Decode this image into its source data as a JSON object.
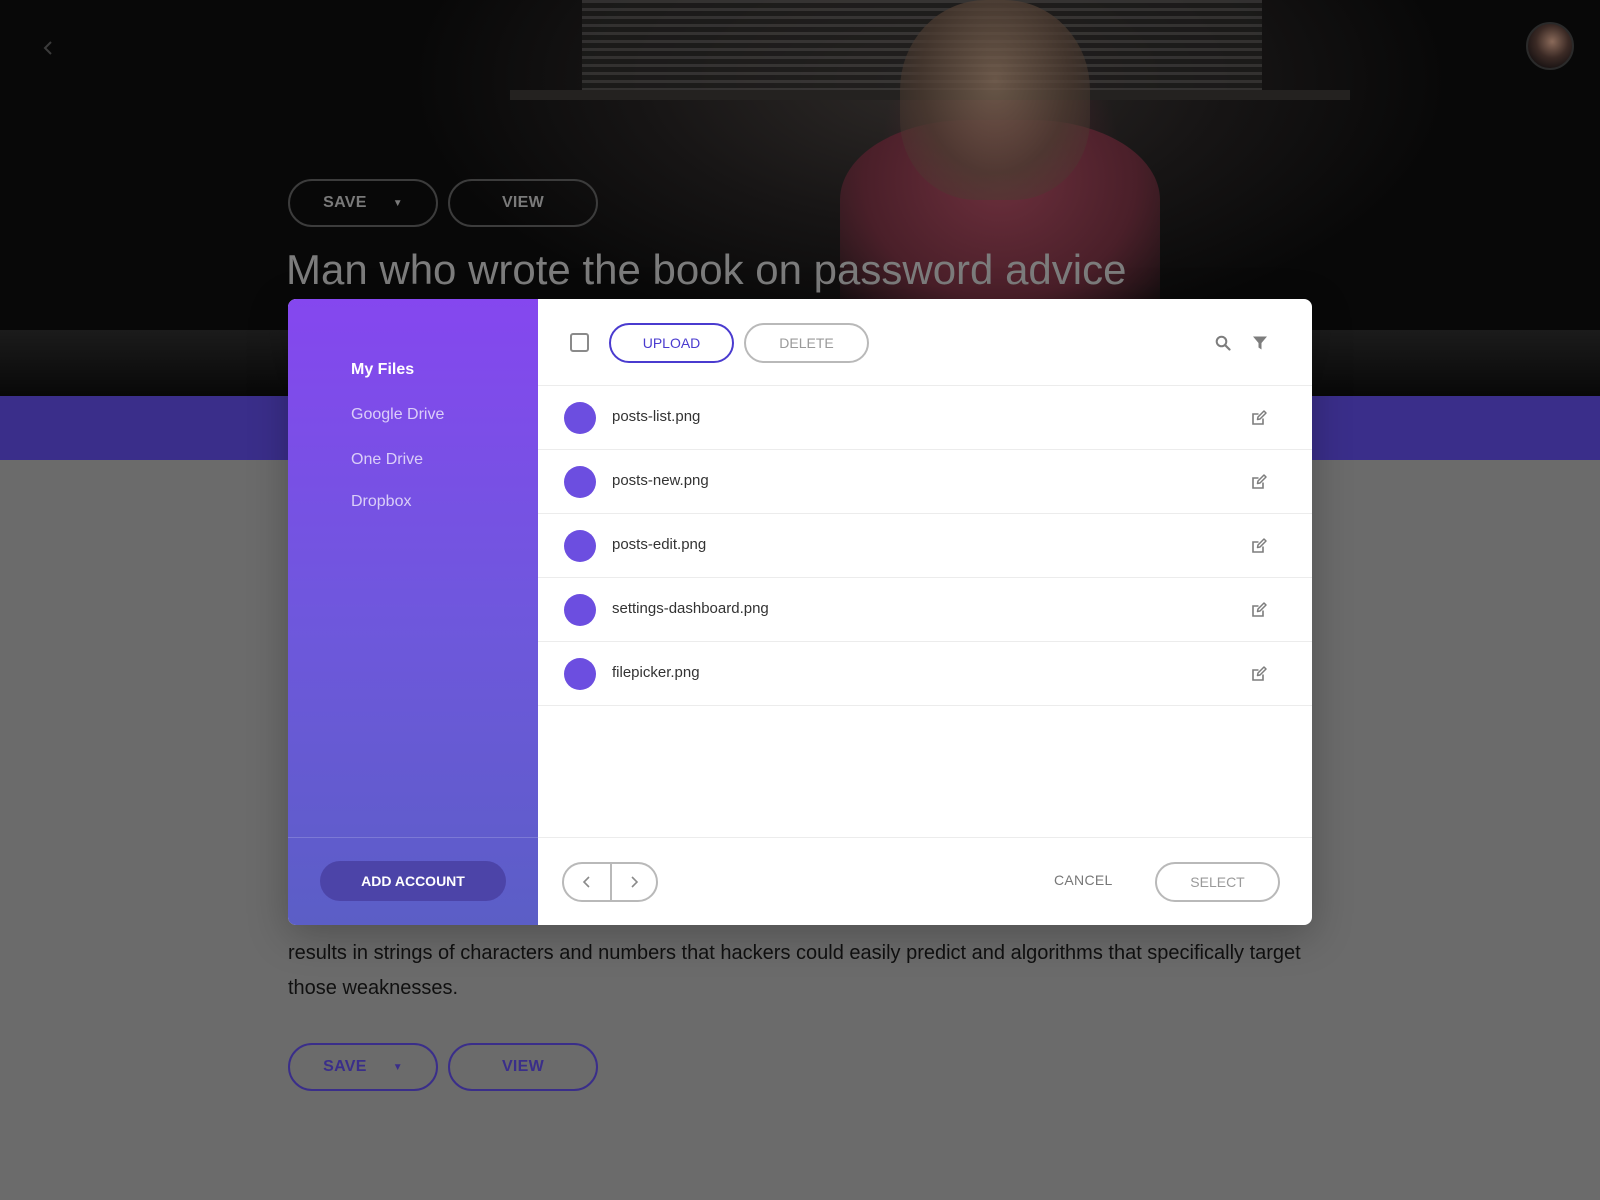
{
  "background": {
    "hero_title": "Man who wrote the book on password advice",
    "hero_actions": {
      "save_label": "SAVE",
      "view_label": "VIEW"
    },
    "article_text": "results in strings of characters and numbers that hackers could easily predict and algorithms that specifically target those weaknesses.",
    "bottom_actions": {
      "save_label": "SAVE",
      "view_label": "VIEW"
    },
    "icons": {
      "back": "chevron-left-icon",
      "avatar": "avatar"
    },
    "colors": {
      "accent": "#3a2e8a"
    }
  },
  "file_picker": {
    "sidebar": {
      "items": [
        {
          "label": "My Files",
          "active": true
        },
        {
          "label": "Google Drive",
          "active": false
        },
        {
          "label": "One Drive",
          "active": false
        },
        {
          "label": "Dropbox",
          "active": false
        }
      ],
      "add_account_label": "ADD ACCOUNT",
      "gradient": [
        "#8547ef",
        "#5b5ec6"
      ]
    },
    "toolbar": {
      "upload_label": "UPLOAD",
      "delete_label": "DELETE",
      "icons": [
        "search-icon",
        "filter-icon"
      ]
    },
    "files": [
      {
        "name": "posts-list.png"
      },
      {
        "name": "posts-new.png"
      },
      {
        "name": "posts-edit.png"
      },
      {
        "name": "settings-dashboard.png"
      },
      {
        "name": "filepicker.png"
      }
    ],
    "footer": {
      "cancel_label": "CANCEL",
      "select_label": "SELECT",
      "pager_icons": [
        "chevron-left-icon",
        "chevron-right-icon"
      ]
    },
    "colors": {
      "primary": "#4a3bcf",
      "file_dot": "#6c4ee0"
    }
  }
}
